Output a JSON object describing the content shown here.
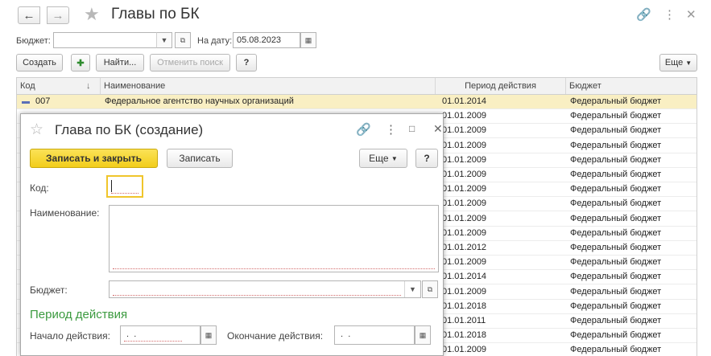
{
  "window": {
    "title": "Главы по БК"
  },
  "filters": {
    "budget_label": "Бюджет:",
    "budget_value": "",
    "date_label": "На дату:",
    "date_value": "05.08.2023"
  },
  "toolbar": {
    "create_label": "Создать",
    "find_label": "Найти...",
    "cancel_search_label": "Отменить поиск",
    "help_label": "?",
    "more_label": "Еще"
  },
  "table": {
    "columns": [
      "Код",
      "Наименование",
      "Период действия",
      "Бюджет"
    ],
    "rows": [
      {
        "code": "007",
        "name": "Федеральное агентство научных организаций",
        "period": "01.01.2014",
        "budget": "Федеральный бюджет"
      },
      {
        "code": "",
        "name": "",
        "period": "01.01.2009",
        "budget": "Федеральный бюджет"
      },
      {
        "code": "",
        "name": "",
        "period": "01.01.2009",
        "budget": "Федеральный бюджет"
      },
      {
        "code": "",
        "name": "",
        "period": "01.01.2009",
        "budget": "Федеральный бюджет"
      },
      {
        "code": "",
        "name": "",
        "period": "01.01.2009",
        "budget": "Федеральный бюджет"
      },
      {
        "code": "",
        "name": "",
        "period": "01.01.2009",
        "budget": "Федеральный бюджет"
      },
      {
        "code": "",
        "name": "",
        "period": "01.01.2009",
        "budget": "Федеральный бюджет"
      },
      {
        "code": "",
        "name": "",
        "period": "01.01.2009",
        "budget": "Федеральный бюджет"
      },
      {
        "code": "",
        "name": "",
        "period": "01.01.2009",
        "budget": "Федеральный бюджет"
      },
      {
        "code": "",
        "name": "",
        "period": "01.01.2009",
        "budget": "Федеральный бюджет"
      },
      {
        "code": "",
        "name": "",
        "period": "01.01.2012",
        "budget": "Федеральный бюджет"
      },
      {
        "code": "",
        "name": "",
        "period": "01.01.2009",
        "budget": "Федеральный бюджет"
      },
      {
        "code": "",
        "name": "",
        "period": "01.01.2014",
        "budget": "Федеральный бюджет"
      },
      {
        "code": "",
        "name": "",
        "period": "01.01.2009",
        "budget": "Федеральный бюджет"
      },
      {
        "code": "",
        "name": "",
        "period": "01.01.2018",
        "budget": "Федеральный бюджет"
      },
      {
        "code": "",
        "name": "",
        "period": "01.01.2011",
        "budget": "Федеральный бюджет"
      },
      {
        "code": "",
        "name": "",
        "period": "01.01.2018",
        "budget": "Федеральный бюджет"
      },
      {
        "code": "",
        "name": "",
        "period": "01.01.2009",
        "budget": "Федеральный бюджет"
      }
    ]
  },
  "dialog": {
    "title": "Глава по БК (создание)",
    "save_close_label": "Записать и закрыть",
    "save_label": "Записать",
    "more_label": "Еще",
    "help_label": "?",
    "code_label": "Код:",
    "code_value": "",
    "name_label": "Наименование:",
    "name_value": "",
    "budget_label": "Бюджет:",
    "budget_value": "",
    "period_section": "Период действия",
    "start_label": "Начало действия:",
    "start_value": " .  .",
    "end_label": "Окончание действия:",
    "end_value": " .  ."
  },
  "colors": {
    "accent_yellow": "#f5d32a",
    "selected_row": "#f9efc3",
    "section_green": "#3b9a3f"
  }
}
